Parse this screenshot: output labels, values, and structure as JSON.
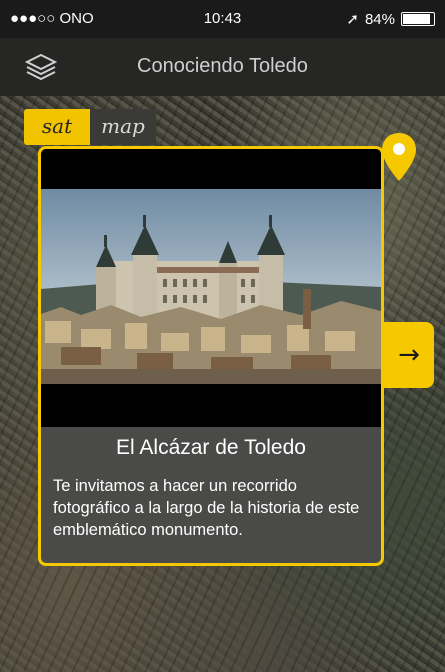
{
  "status_bar": {
    "carrier": "●●●○○ ONO",
    "time": "10:43",
    "battery": "84%",
    "battery_level": 0.84
  },
  "nav": {
    "title": "Conociendo Toledo",
    "layers_icon": "layers-icon"
  },
  "map_toggle": {
    "sat_label": "sat",
    "map_label": "map",
    "selected": "sat"
  },
  "card": {
    "title": "El Alcázar de Toledo",
    "description": "Te invitamos a hacer un recorrido fotográfico a la largo de la historia de este emblemático monumento.",
    "next_icon": "→"
  },
  "colors": {
    "accent": "#f6c800",
    "card_bg": "#4a4a48",
    "bar_bg": "#262625"
  }
}
